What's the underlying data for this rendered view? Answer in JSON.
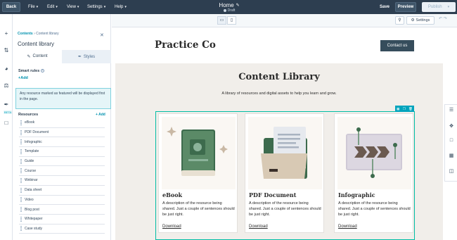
{
  "topbar": {
    "back_label": "Back",
    "menus": [
      "File",
      "Edit",
      "View",
      "Settings",
      "Help"
    ],
    "page_name": "Home",
    "status": "Draft",
    "save_label": "Save",
    "preview_label": "Preview",
    "publish_label": "Publish"
  },
  "rail": {
    "beta_badge": "BETA"
  },
  "panel": {
    "breadcrumb_root": "Contents",
    "breadcrumb_current": "Content library",
    "title": "Content library",
    "tab_content": "Content",
    "tab_styles": "Styles",
    "smart_rules_label": "Smart rules",
    "add_label": "Add",
    "note": "Any resource marked as featured will be displayed first in the page.",
    "resources_label": "Resources",
    "resources_add": "Add",
    "resources": [
      "eBook",
      "PDF Document",
      "Infographic",
      "Template",
      "Guide",
      "Course",
      "Webinar",
      "Data sheet",
      "Video",
      "Blog post",
      "Whitepaper",
      "Case study"
    ]
  },
  "toolbar": {
    "settings_label": "Settings"
  },
  "site": {
    "brand": "Practice Co",
    "contact_label": "Contact us",
    "library_title": "Content Library",
    "library_subtitle": "A library of resources and digital assets to help you learn and grow."
  },
  "cards": [
    {
      "title": "eBook",
      "description": "A description of the resource being shared. Just a couple of sentences should be just right.",
      "link": "Download"
    },
    {
      "title": "PDF Document",
      "description": "A description of the resource being shared. Just a couple of sentences should be just right.",
      "link": "Download"
    },
    {
      "title": "Infographic",
      "description": "A description of the resource being shared. Just a couple of sentences should be just right.",
      "link": "Download"
    }
  ],
  "colors": {
    "topbar": "#2d3e50",
    "accent": "#0091ae",
    "module_outline": "#00bda5",
    "canvas_bg": "#f1eeea",
    "brand_button": "#364d5c"
  }
}
